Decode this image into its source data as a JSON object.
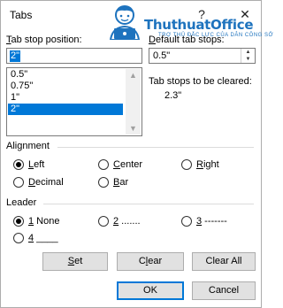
{
  "title": "Tabs",
  "titlebar": {
    "help_glyph": "?",
    "close_glyph": "✕"
  },
  "logo": {
    "text": "ThuthuatOffice",
    "sub": "TRỢ THỦ ĐẮC LỰC CỦA DÂN CÔNG SỞ"
  },
  "tab_stop": {
    "label": "Tab stop position:",
    "value": "2\"",
    "list": [
      "0.5\"",
      "0.75\"",
      "1\"",
      "2\""
    ],
    "selected_index": 3
  },
  "default_tab": {
    "label": "Default tab stops:",
    "value": "0.5\""
  },
  "to_clear": {
    "label": "Tab stops to be cleared:",
    "value": "2.3\""
  },
  "alignment": {
    "title": "Alignment",
    "options": [
      "Left",
      "Center",
      "Right",
      "Decimal",
      "Bar"
    ],
    "selected": "Left"
  },
  "leader": {
    "title": "Leader",
    "options": [
      "1 None",
      "2 .......",
      "3 -------",
      "4 ____"
    ],
    "selected": "1 None"
  },
  "buttons": {
    "set": "Set",
    "clear": "Clear",
    "clear_all": "Clear All",
    "ok": "OK",
    "cancel": "Cancel"
  },
  "colors": {
    "accent": "#0078d7",
    "logo": "#1e73be"
  }
}
